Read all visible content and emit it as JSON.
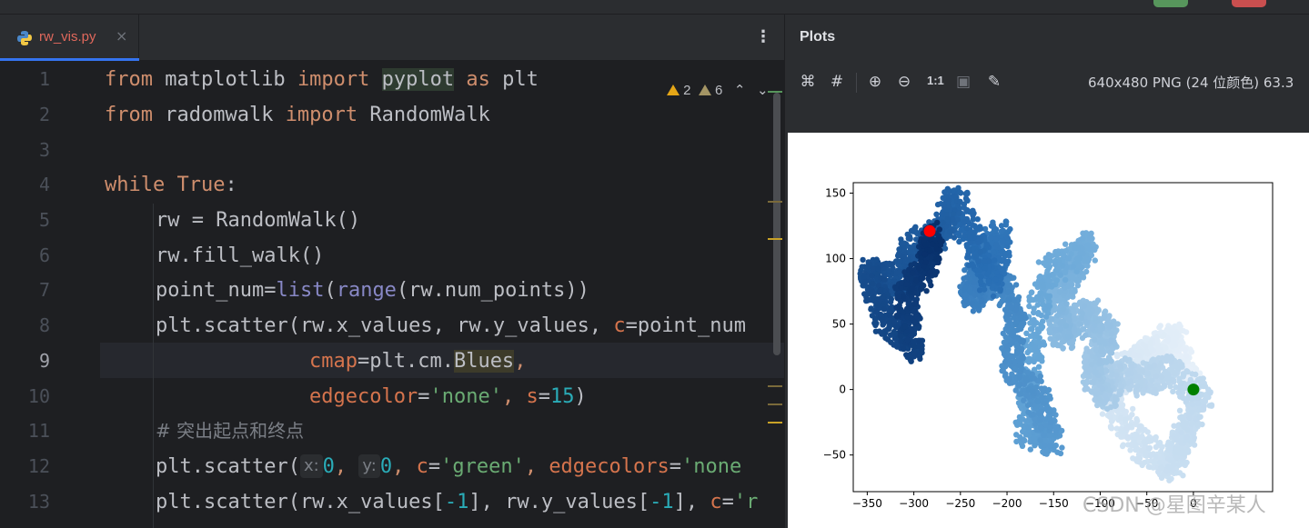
{
  "editor": {
    "tab": {
      "filename": "rw_vis.py",
      "close": "×",
      "more": "⋮"
    },
    "inspections": {
      "warnings": "2",
      "weak_warnings": "6",
      "up": "⌃",
      "down": "⌄"
    },
    "line_numbers": [
      "1",
      "2",
      "3",
      "4",
      "5",
      "6",
      "7",
      "8",
      "9",
      "10",
      "11",
      "12",
      "13"
    ],
    "current_line": "9",
    "code": {
      "l1": {
        "from": "from",
        "mod": " matplotlib ",
        "import": "import",
        "sp": " ",
        "name": "pyplot",
        "sp2": " ",
        "as": "as",
        "alias": " plt"
      },
      "l2": {
        "from": "from",
        "mod": " radomwalk ",
        "import": "import",
        "name": " RandomWalk"
      },
      "l4": {
        "while": "while",
        "sp": " ",
        "true": "True",
        "colon": ":"
      },
      "l5": {
        "text": "rw = RandomWalk()"
      },
      "l6": {
        "text": "rw.fill_walk()"
      },
      "l7": {
        "a": "point_num",
        "eq": "=",
        "list": "list",
        "p1": "(",
        "range": "range",
        "b": "(rw.num_points))"
      },
      "l8": {
        "a": "plt.scatter(rw.x_values, rw.y_values, ",
        "c": "c",
        "b": "=point_num"
      },
      "l9": {
        "cmap": "cmap",
        "a": "=plt.cm.",
        "blues": "Blues",
        "comma": ","
      },
      "l10": {
        "edge": "edgecolor",
        "eq": "=",
        "str": "'none'",
        "a": ", ",
        "s": "s",
        "eq2": "=",
        "num": "15",
        "b": ")"
      },
      "l11": {
        "text": "# 突出起点和终点"
      },
      "l12": {
        "a": "plt.scatter(",
        "hx": "x:",
        "v0": "0",
        "sep": ", ",
        "hy": "y:",
        "v1": "0",
        "sep2": ", ",
        "c": "c",
        "eq": "=",
        "green": "'green'",
        "sep3": ", ",
        "ec": "edgecolors",
        "eq2": "=",
        "none": "'none"
      },
      "l13": {
        "a": "plt.scatter(rw.x_values[",
        "n1": "-1",
        "b": "], rw.y_values[",
        "n2": "-1",
        "c2": "], ",
        "c": "c",
        "eq": "=",
        "r": "'r"
      }
    }
  },
  "plots": {
    "title": "Plots",
    "zoom_ratio": "1:1",
    "image_info": "640x480 PNG (24 位颜色) 63.3",
    "icons": [
      "fit-icon",
      "crop-icon",
      "zoom-in-icon",
      "zoom-out-icon",
      "actual-size-icon",
      "background-icon",
      "color-picker-icon"
    ]
  },
  "watermark": "CSDN @星图辛某人",
  "chart_data": {
    "type": "scatter",
    "title": "",
    "xlabel": "",
    "ylabel": "",
    "xlim": [
      -365,
      85
    ],
    "ylim": [
      -78,
      158
    ],
    "xticks": [
      -350,
      -300,
      -250,
      -200,
      -150,
      -100,
      -50,
      0
    ],
    "yticks": [
      -50,
      0,
      50,
      100,
      150
    ],
    "colormap": "Blues (reversed order: start light, end dark)",
    "walk_path_waypoints": [
      [
        0,
        0
      ],
      [
        -20,
        40
      ],
      [
        -45,
        30
      ],
      [
        -70,
        20
      ],
      [
        -90,
        -10
      ],
      [
        -60,
        -40
      ],
      [
        -25,
        -60
      ],
      [
        -10,
        -35
      ],
      [
        10,
        -5
      ],
      [
        -30,
        15
      ],
      [
        -60,
        5
      ],
      [
        -85,
        15
      ],
      [
        -95,
        -5
      ],
      [
        -110,
        15
      ],
      [
        -90,
        40
      ],
      [
        -115,
        60
      ],
      [
        -140,
        40
      ],
      [
        -150,
        70
      ],
      [
        -130,
        90
      ],
      [
        -115,
        110
      ],
      [
        -160,
        85
      ],
      [
        -175,
        20
      ],
      [
        -180,
        -30
      ],
      [
        -150,
        -40
      ],
      [
        -165,
        -10
      ],
      [
        -195,
        20
      ],
      [
        -190,
        60
      ],
      [
        -210,
        85
      ],
      [
        -240,
        70
      ],
      [
        -230,
        100
      ],
      [
        -205,
        120
      ],
      [
        -215,
        80
      ],
      [
        -235,
        110
      ],
      [
        -255,
        145
      ],
      [
        -270,
        120
      ],
      [
        -300,
        110
      ],
      [
        -315,
        80
      ],
      [
        -350,
        90
      ],
      [
        -330,
        55
      ],
      [
        -300,
        30
      ],
      [
        -310,
        70
      ],
      [
        -285,
        95
      ],
      [
        -280,
        120
      ]
    ],
    "start_point": {
      "x": 0,
      "y": 0,
      "color": "green"
    },
    "end_point": {
      "x": -283,
      "y": 121,
      "color": "red"
    }
  }
}
